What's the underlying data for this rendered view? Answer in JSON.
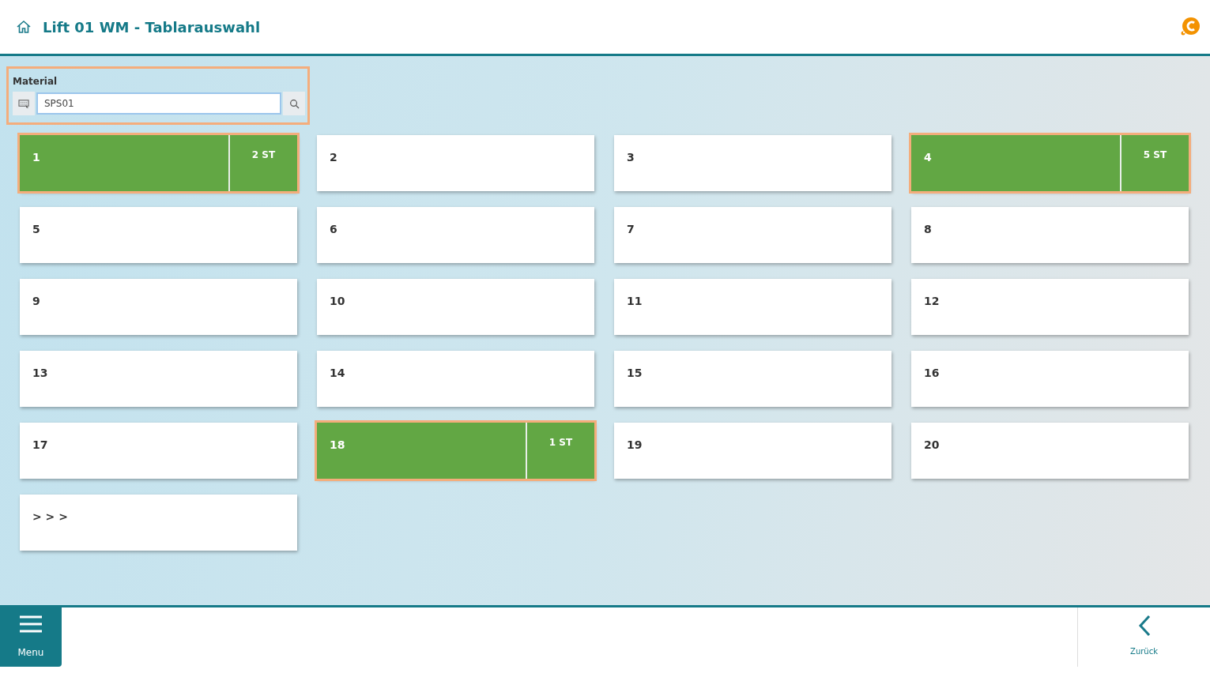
{
  "header": {
    "title": "Lift 01 WM - Tablarauswahl"
  },
  "material": {
    "label": "Material",
    "value": "SPS01"
  },
  "tiles": [
    {
      "label": "1",
      "selected": true,
      "count": "2 ST"
    },
    {
      "label": "2",
      "selected": false
    },
    {
      "label": "3",
      "selected": false
    },
    {
      "label": "4",
      "selected": true,
      "count": "5 ST"
    },
    {
      "label": "5",
      "selected": false
    },
    {
      "label": "6",
      "selected": false
    },
    {
      "label": "7",
      "selected": false
    },
    {
      "label": "8",
      "selected": false
    },
    {
      "label": "9",
      "selected": false
    },
    {
      "label": "10",
      "selected": false
    },
    {
      "label": "11",
      "selected": false
    },
    {
      "label": "12",
      "selected": false
    },
    {
      "label": "13",
      "selected": false
    },
    {
      "label": "14",
      "selected": false
    },
    {
      "label": "15",
      "selected": false
    },
    {
      "label": "16",
      "selected": false
    },
    {
      "label": "17",
      "selected": false
    },
    {
      "label": "18",
      "selected": true,
      "count": "1 ST"
    },
    {
      "label": "19",
      "selected": false
    },
    {
      "label": "20",
      "selected": false
    },
    {
      "label": "> > >",
      "selected": false
    }
  ],
  "footer": {
    "menu": "Menu",
    "back": "Zurück"
  }
}
